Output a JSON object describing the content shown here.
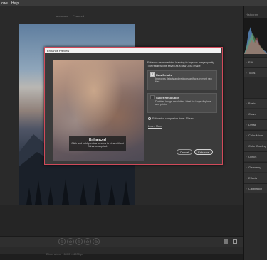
{
  "menubar": {
    "items": [
      "ows",
      "Help"
    ]
  },
  "fileinfo": {
    "left": "landscape",
    "right": "Featured"
  },
  "dialog": {
    "title": "Enhance Preview",
    "preview_overlay_title": "Enhanced",
    "preview_overlay_desc": "Click and hold preview window to view without Enhance applied.",
    "description": "Enhance uses machine learning to improve image quality. The result will be saved as a new DNG image.",
    "raw_details": {
      "label": "Raw Details",
      "checked": true,
      "desc": "Improves details and reduces artifacts in most raw files."
    },
    "super_resolution": {
      "label": "Super Resolution",
      "checked": false,
      "desc": "Doubles image resolution. Ideal for large displays and prints."
    },
    "estimate": "Estimated completion time: 10 sec",
    "learn_more": "Learn More",
    "cancel_label": "Cancel",
    "enhance_label": "Enhance"
  },
  "right_panel": {
    "top_label": "Histogram",
    "items": [
      "Edit",
      "Tools",
      "Basic",
      "Curve",
      "Detail",
      "Color Mixer",
      "Color Grading",
      "Optics",
      "Geometry",
      "Effects",
      "Calibration"
    ]
  },
  "bottom": {
    "info": "Dimensions · 6000 × 4000 px",
    "page_label": "10"
  },
  "colors": {
    "accent": "#d14a5a",
    "dialog_bg": "#3b3b3b",
    "workspace_bg": "#2a2a2a"
  },
  "icons": [
    "star-icon",
    "chevron-right-icon",
    "checkbox-icon",
    "clock-icon",
    "grid-view-icon",
    "compare-view-icon"
  ]
}
